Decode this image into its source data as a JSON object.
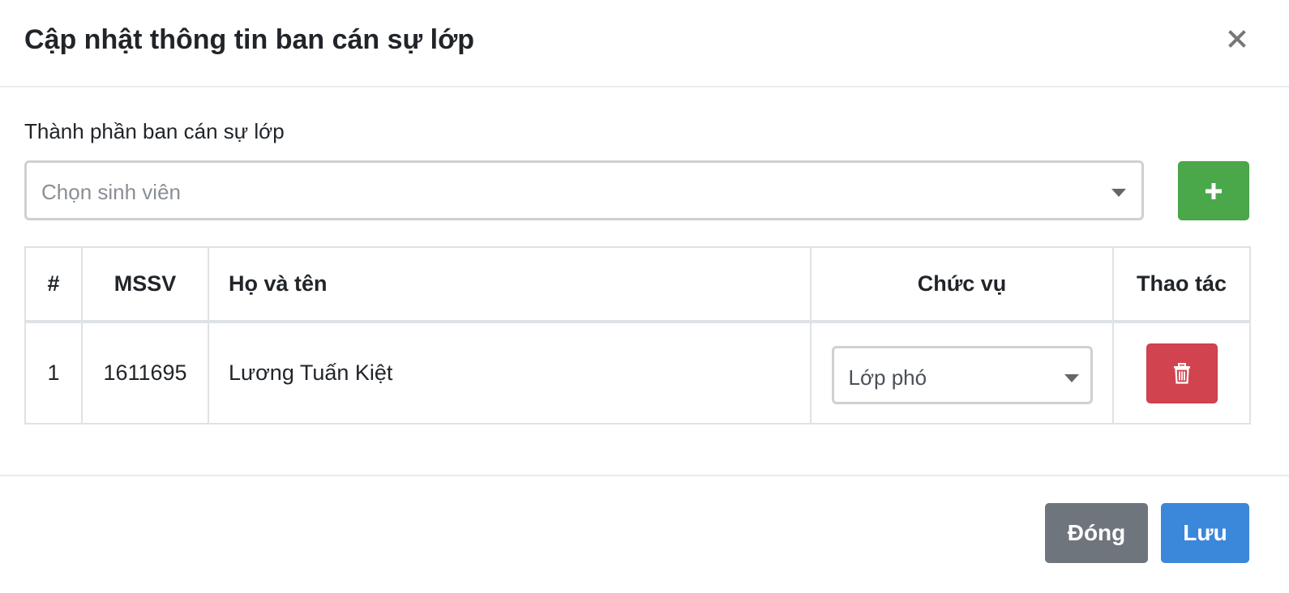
{
  "modal": {
    "title": "Cập nhật thông tin ban cán sự lớp",
    "close_icon": "close-icon"
  },
  "form": {
    "label": "Thành phần ban cán sự lớp",
    "student_select": {
      "placeholder": "Chọn sinh viên",
      "icon": "chevron-down-icon"
    },
    "add_button": {
      "icon": "plus-icon",
      "color": "#4aa84a"
    }
  },
  "table": {
    "headers": [
      "#",
      "MSSV",
      "Họ và tên",
      "Chức vụ",
      "Thao tác"
    ],
    "rows": [
      {
        "index": "1",
        "mssv": "1611695",
        "name": "Lương Tuấn Kiệt",
        "role": "Lớp phó",
        "action_icon": "trash-icon"
      }
    ]
  },
  "footer": {
    "close_label": "Đóng",
    "save_label": "Lưu"
  },
  "colors": {
    "success": "#4aa84a",
    "danger": "#d1434e",
    "secondary": "#6e757c",
    "primary": "#3b87d9"
  }
}
